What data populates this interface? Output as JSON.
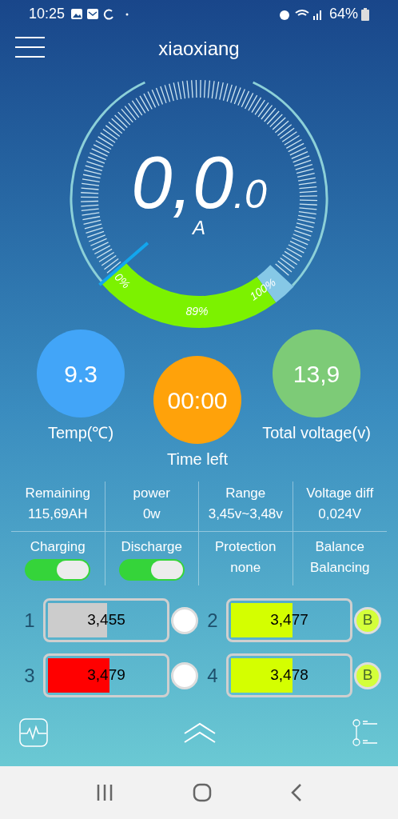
{
  "status_bar": {
    "time": "10:25",
    "battery": "64%"
  },
  "header": {
    "title": "xiaoxiang"
  },
  "gauge": {
    "current": "0,0",
    "current_decimal": ".0",
    "unit": "A",
    "soc_label": "89%",
    "min_label": "0%",
    "max_label": "100%"
  },
  "circles": [
    {
      "value": "9.3",
      "label": "Temp(℃)",
      "color": "#42a5f8"
    },
    {
      "value": "00:00",
      "label": "Time left",
      "color": "#ffa20a"
    },
    {
      "value": "13,9",
      "label": "Total voltage(v)",
      "color": "#7dcb77"
    }
  ],
  "stats": [
    {
      "label": "Remaining",
      "value": "115,69AH"
    },
    {
      "label": "power",
      "value": "0w"
    },
    {
      "label": "Range",
      "value": "3,45v~3,48v"
    },
    {
      "label": "Voltage diff",
      "value": "0,024V"
    }
  ],
  "controls": [
    {
      "kind": "toggle",
      "label": "Charging",
      "on": true
    },
    {
      "kind": "toggle",
      "label": "Discharge",
      "on": true
    },
    {
      "kind": "text",
      "label": "Protection",
      "value": "none"
    },
    {
      "kind": "text",
      "label": "Balance",
      "value": "Balancing"
    }
  ],
  "cells": [
    {
      "index": "1",
      "value": "3,455",
      "level": 0.51,
      "color": "#cccccc",
      "balancing": false
    },
    {
      "index": "2",
      "value": "3,477",
      "level": 0.53,
      "color": "#d4ff00",
      "balancing": true,
      "badge": "B"
    },
    {
      "index": "3",
      "value": "3,479",
      "level": 0.53,
      "color": "#ff0000",
      "balancing": false
    },
    {
      "index": "4",
      "value": "3,478",
      "level": 0.53,
      "color": "#d4ff00",
      "balancing": true,
      "badge": "B"
    }
  ]
}
